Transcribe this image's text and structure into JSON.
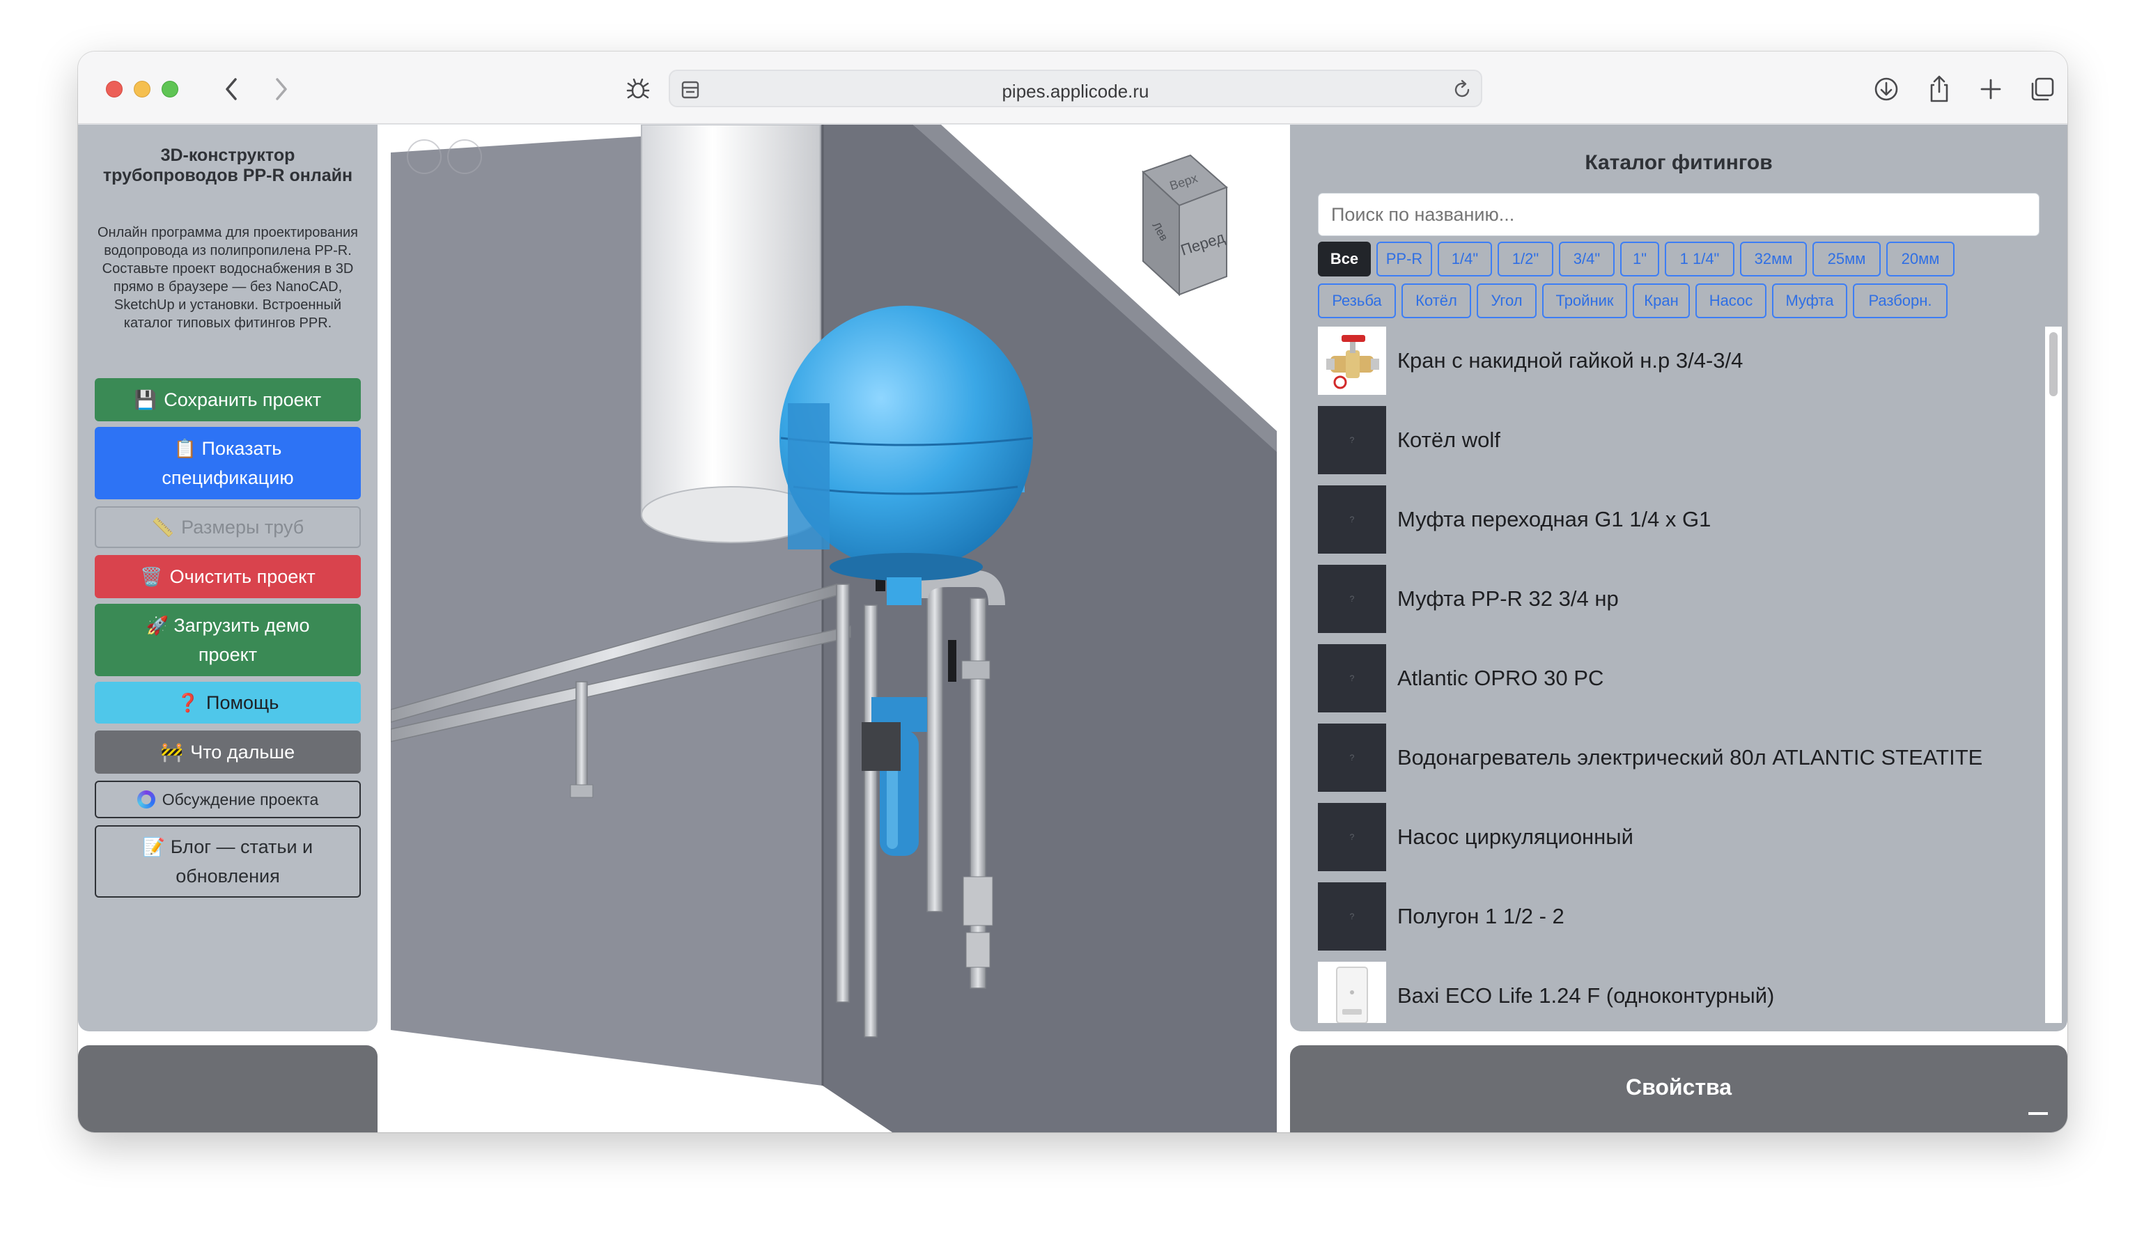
{
  "browser": {
    "url": "pipes.applicode.ru"
  },
  "sidebar": {
    "title": "3D-конструктор трубопроводов PP-R онлайн",
    "description": "Онлайн программа для проектирования водопровода из полипропилена PP-R. Составьте проект водоснабжения в 3D прямо в браузере — без NanoCAD, SketchUp и установки. Встроенный каталог типовых фитингов PPR.",
    "buttons": {
      "save": {
        "icon": "💾",
        "label": "Сохранить проект",
        "color": "#3a8a55"
      },
      "spec": {
        "icon": "📋",
        "label": "Показать спецификацию",
        "color": "#2d73f5"
      },
      "sizes": {
        "icon": "📏",
        "label": "Размеры труб",
        "color": "#b7bcc3"
      },
      "clear": {
        "icon": "🗑️",
        "label": "Очистить проект",
        "color": "#d9434d"
      },
      "demo": {
        "icon": "🚀",
        "label": "Загрузить демо проект",
        "color": "#3a8a55"
      },
      "help": {
        "icon": "❓",
        "label": "Помощь",
        "color": "#4fc7ea"
      },
      "next": {
        "icon": "🚧",
        "label": "Что дальше",
        "color": "#6c6e73"
      },
      "discuss": {
        "label": "Обсуждение проекта"
      },
      "blog": {
        "icon": "📝",
        "label": "Блог — статьи и обновления"
      }
    }
  },
  "viewcube": {
    "top": "Верх",
    "front": "Перед",
    "left": "Лев"
  },
  "catalog": {
    "title": "Каталог фитингов",
    "search_placeholder": "Поиск по названию...",
    "filters_row1": [
      "Все",
      "PP-R",
      "1/4\"",
      "1/2\"",
      "3/4\"",
      "1\"",
      "1 1/4\"",
      "32мм",
      "25мм",
      "20мм"
    ],
    "filters_row2": [
      "Резьба",
      "Котёл",
      "Угол",
      "Тройник",
      "Кран",
      "Насос",
      "Муфта",
      "Разборн."
    ],
    "active_filter": "Все",
    "items": [
      {
        "name": "Кран с накидной гайкой н.р 3/4-3/4",
        "thumb": "valve-photo"
      },
      {
        "name": "Котёл wolf",
        "thumb": "placeholder"
      },
      {
        "name": "Муфта переходная G1 1/4 x G1",
        "thumb": "placeholder"
      },
      {
        "name": "Муфта PP-R 32 3/4 нр",
        "thumb": "placeholder"
      },
      {
        "name": "Atlantic OPRO 30 PC",
        "thumb": "placeholder"
      },
      {
        "name": "Водонагреватель электрический 80л ATLANTIC STEATITE",
        "thumb": "placeholder"
      },
      {
        "name": "Насос циркуляционный",
        "thumb": "placeholder"
      },
      {
        "name": "Полугон 1 1/2 - 2",
        "thumb": "placeholder"
      },
      {
        "name": "Baxi ECO Life 1.24 F (одноконтурный)",
        "thumb": "boiler-photo"
      }
    ]
  },
  "properties": {
    "title": "Свойства"
  }
}
